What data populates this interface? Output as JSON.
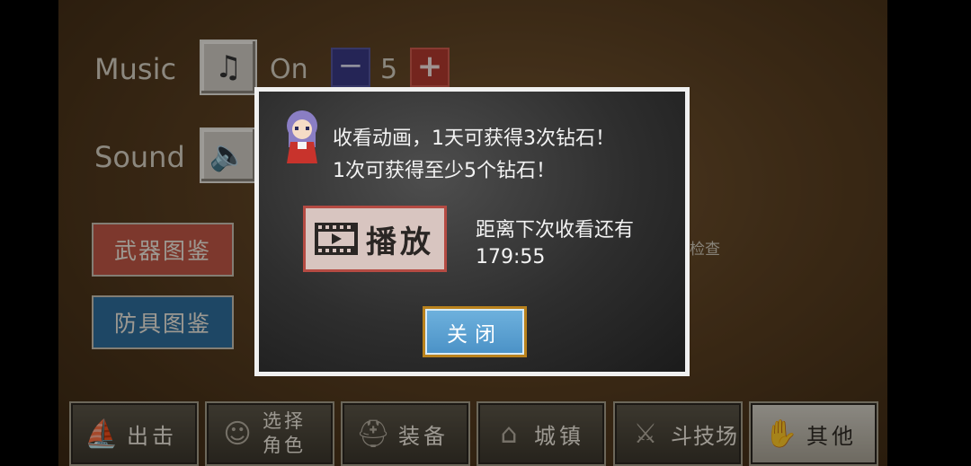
{
  "settings": {
    "music_label": "Music",
    "music_state": "On",
    "music_volume": "5",
    "sound_label": "Sound",
    "minus_symbol": "−",
    "plus_symbol": "+"
  },
  "side_buttons": {
    "weapon_book": "武器图鉴",
    "armor_book": "防具图鉴",
    "check_partial": "检查"
  },
  "dialog": {
    "line1": "收看动画，1天可获得3次钻石！",
    "line2": "1次可获得至少5个钻石！",
    "play_label": "播放",
    "wait_label": "距离下次收看还有",
    "countdown": "179:55",
    "close_label": "关闭"
  },
  "bottom_tabs": [
    {
      "label": "出击",
      "icon": "boat-icon"
    },
    {
      "label_line1": "选择",
      "label_line2": "角色",
      "icon": "character-select-icon"
    },
    {
      "label": "装备",
      "icon": "helmet-icon"
    },
    {
      "label": "城镇",
      "icon": "town-icon"
    },
    {
      "label": "斗技场",
      "icon": "crossed-swords-icon"
    },
    {
      "label": "其他",
      "icon": "hand-icon"
    }
  ],
  "colors": {
    "weapon_button": "#c15645",
    "armor_button": "#2f6e9c",
    "close_button": "#4a91c6",
    "play_border": "#b54b43"
  }
}
